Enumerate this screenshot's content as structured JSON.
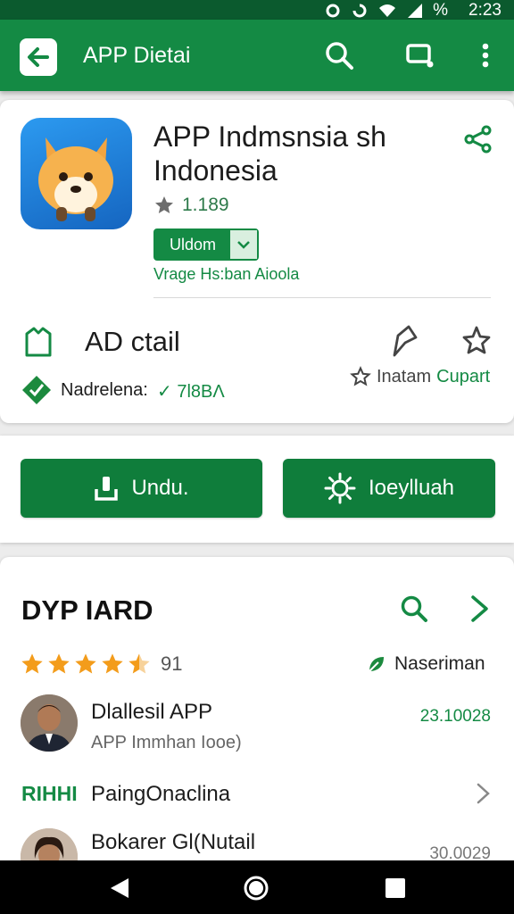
{
  "status_bar": {
    "time": "2:23",
    "battery": "%"
  },
  "app_bar": {
    "title": "APP Dietai"
  },
  "app": {
    "title": "APP Indmsnsia sh Indonesia",
    "rating": "1.189",
    "badge_label": "Uldom",
    "developer": "Vrage Hs:ban Aioola"
  },
  "detail": {
    "title": "AD ctail",
    "meta_label": "Nadrelena:",
    "meta_value": "✓ 7l8BΛ",
    "wishlist_label": "Inatam",
    "wishlist_value": "Cupart"
  },
  "actions": {
    "download_label": "Undu.",
    "secondary_label": "Ioeylluah"
  },
  "reviews": {
    "title": "DYP IARD",
    "stars_value": 4.5,
    "star_count": "91",
    "version_tag": "Naseriman",
    "items": [
      {
        "name": "Dlallesil APP",
        "subtitle": "APP Immhan Iooe)",
        "date": "23.10028"
      },
      {
        "name": "Bokarer Gl(Nutail",
        "subtitle": "",
        "date": "30.0029"
      }
    ],
    "category": {
      "tag": "RIHHI",
      "label": "PaingOnaclina"
    }
  },
  "colors": {
    "primary": "#148a44",
    "primary_dark": "#0b5a2e",
    "button": "#0f7d3b",
    "star": "#f39c1b"
  },
  "icons": [
    "back-arrow-icon",
    "search-icon",
    "cast-icon",
    "more-vert-icon",
    "share-icon",
    "star-icon",
    "bookmark-icon",
    "pin-icon",
    "download-icon",
    "sun-icon",
    "chevron-right-icon",
    "leaf-icon",
    "gem-icon",
    "back-triangle-icon",
    "home-circle-icon",
    "recents-square-icon"
  ]
}
